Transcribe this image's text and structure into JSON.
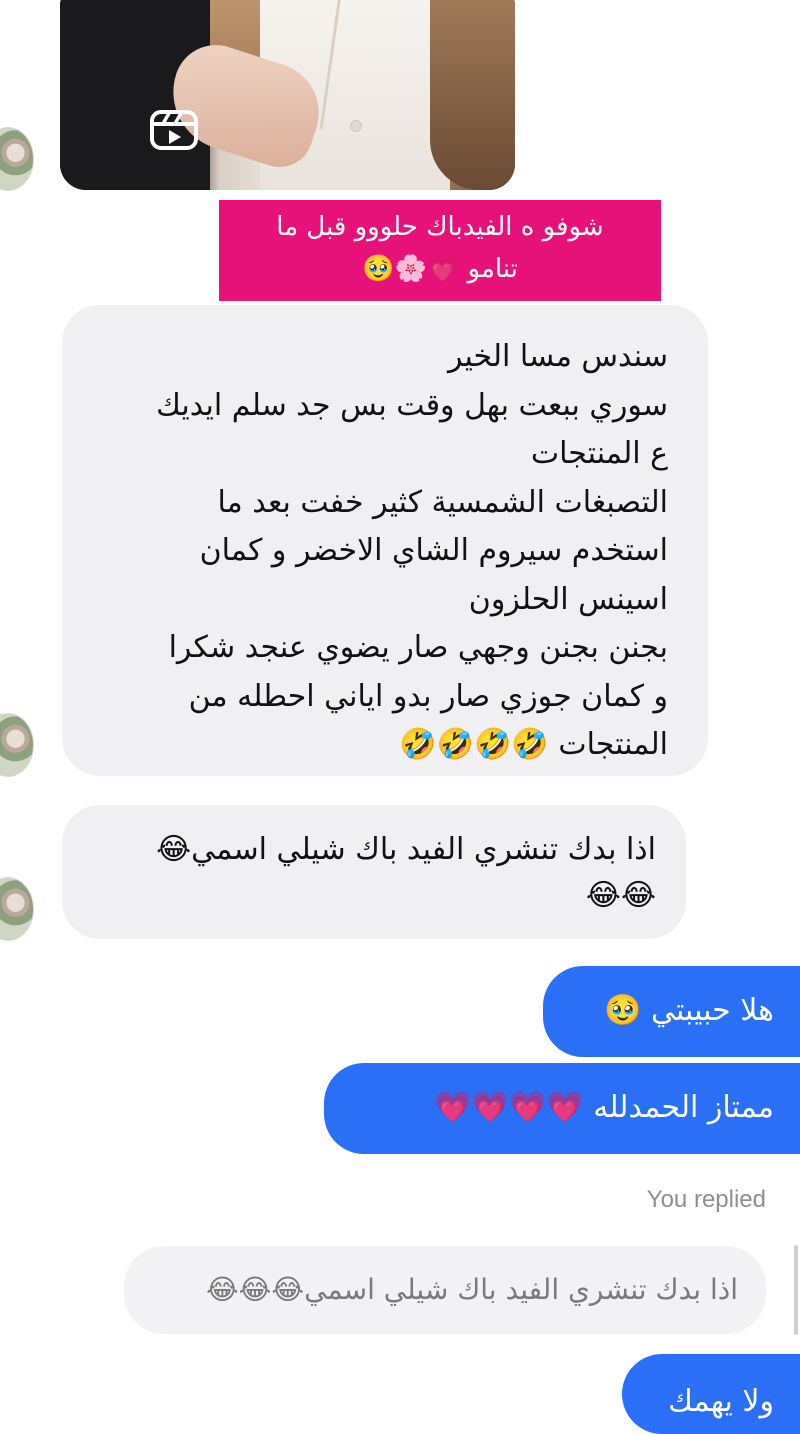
{
  "reel_share": {
    "icon": "reels-icon"
  },
  "caption": {
    "line1": "شوفو ه الفيدباك حلووو قبل ما",
    "line2": "تنامو 💗🌸🥹"
  },
  "messages": {
    "incoming_1": {
      "line1": "سندس مسا الخير",
      "line2": "سوري ببعت بهل وقت بس جد سلم ايديك",
      "line3": "ع المنتجات",
      "line4": "التصبغات الشمسية كثير خفت بعد ما",
      "line5": "استخدم سيروم الشاي الاخضر و كمان",
      "line6": "اسينس الحلزون",
      "line7": "بجنن بجنن وجهي صار يضوي عنجد شكرا",
      "line8": "و كمان جوزي صار بدو اياني احطله من",
      "line9": "المنتجات 🤣🤣🤣🤣"
    },
    "incoming_2": {
      "line1": "اذا بدك تنشري الفيد باك شيلي اسمي😂",
      "line2": "😂😂"
    },
    "outgoing_1": "هلا حبيبتي 🥹",
    "outgoing_2": "ممتاز الحمدلله 💗💗💗💗",
    "replied_label": "You replied",
    "quoted_text": "اذا بدك تنشري الفيد باك شيلي اسمي😂😂😂",
    "outgoing_3": "ولا يهمك"
  }
}
